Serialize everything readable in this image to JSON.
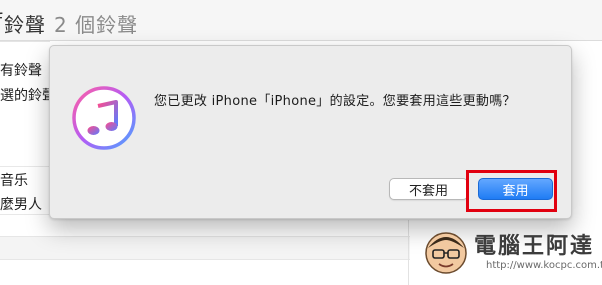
{
  "background": {
    "title": "鈴聲",
    "title_prefix_partial": "f",
    "count": "2 個鈴聲",
    "labels": [
      "有鈴聲",
      "選的鈴聲",
      "音乐",
      "麼男人"
    ]
  },
  "dialog": {
    "app_icon": "itunes-icon",
    "message": "您已更改 iPhone「iPhone」的設定。您要套用這些更動嗎？",
    "cancel_label": "不套用",
    "apply_label": "套用"
  },
  "annotation": {
    "highlight_color": "#e1000f"
  },
  "watermark": {
    "title": "電腦王阿達",
    "url": "http://www.kocpc.com.tw"
  },
  "colors": {
    "accent": "#1f7cf4"
  }
}
